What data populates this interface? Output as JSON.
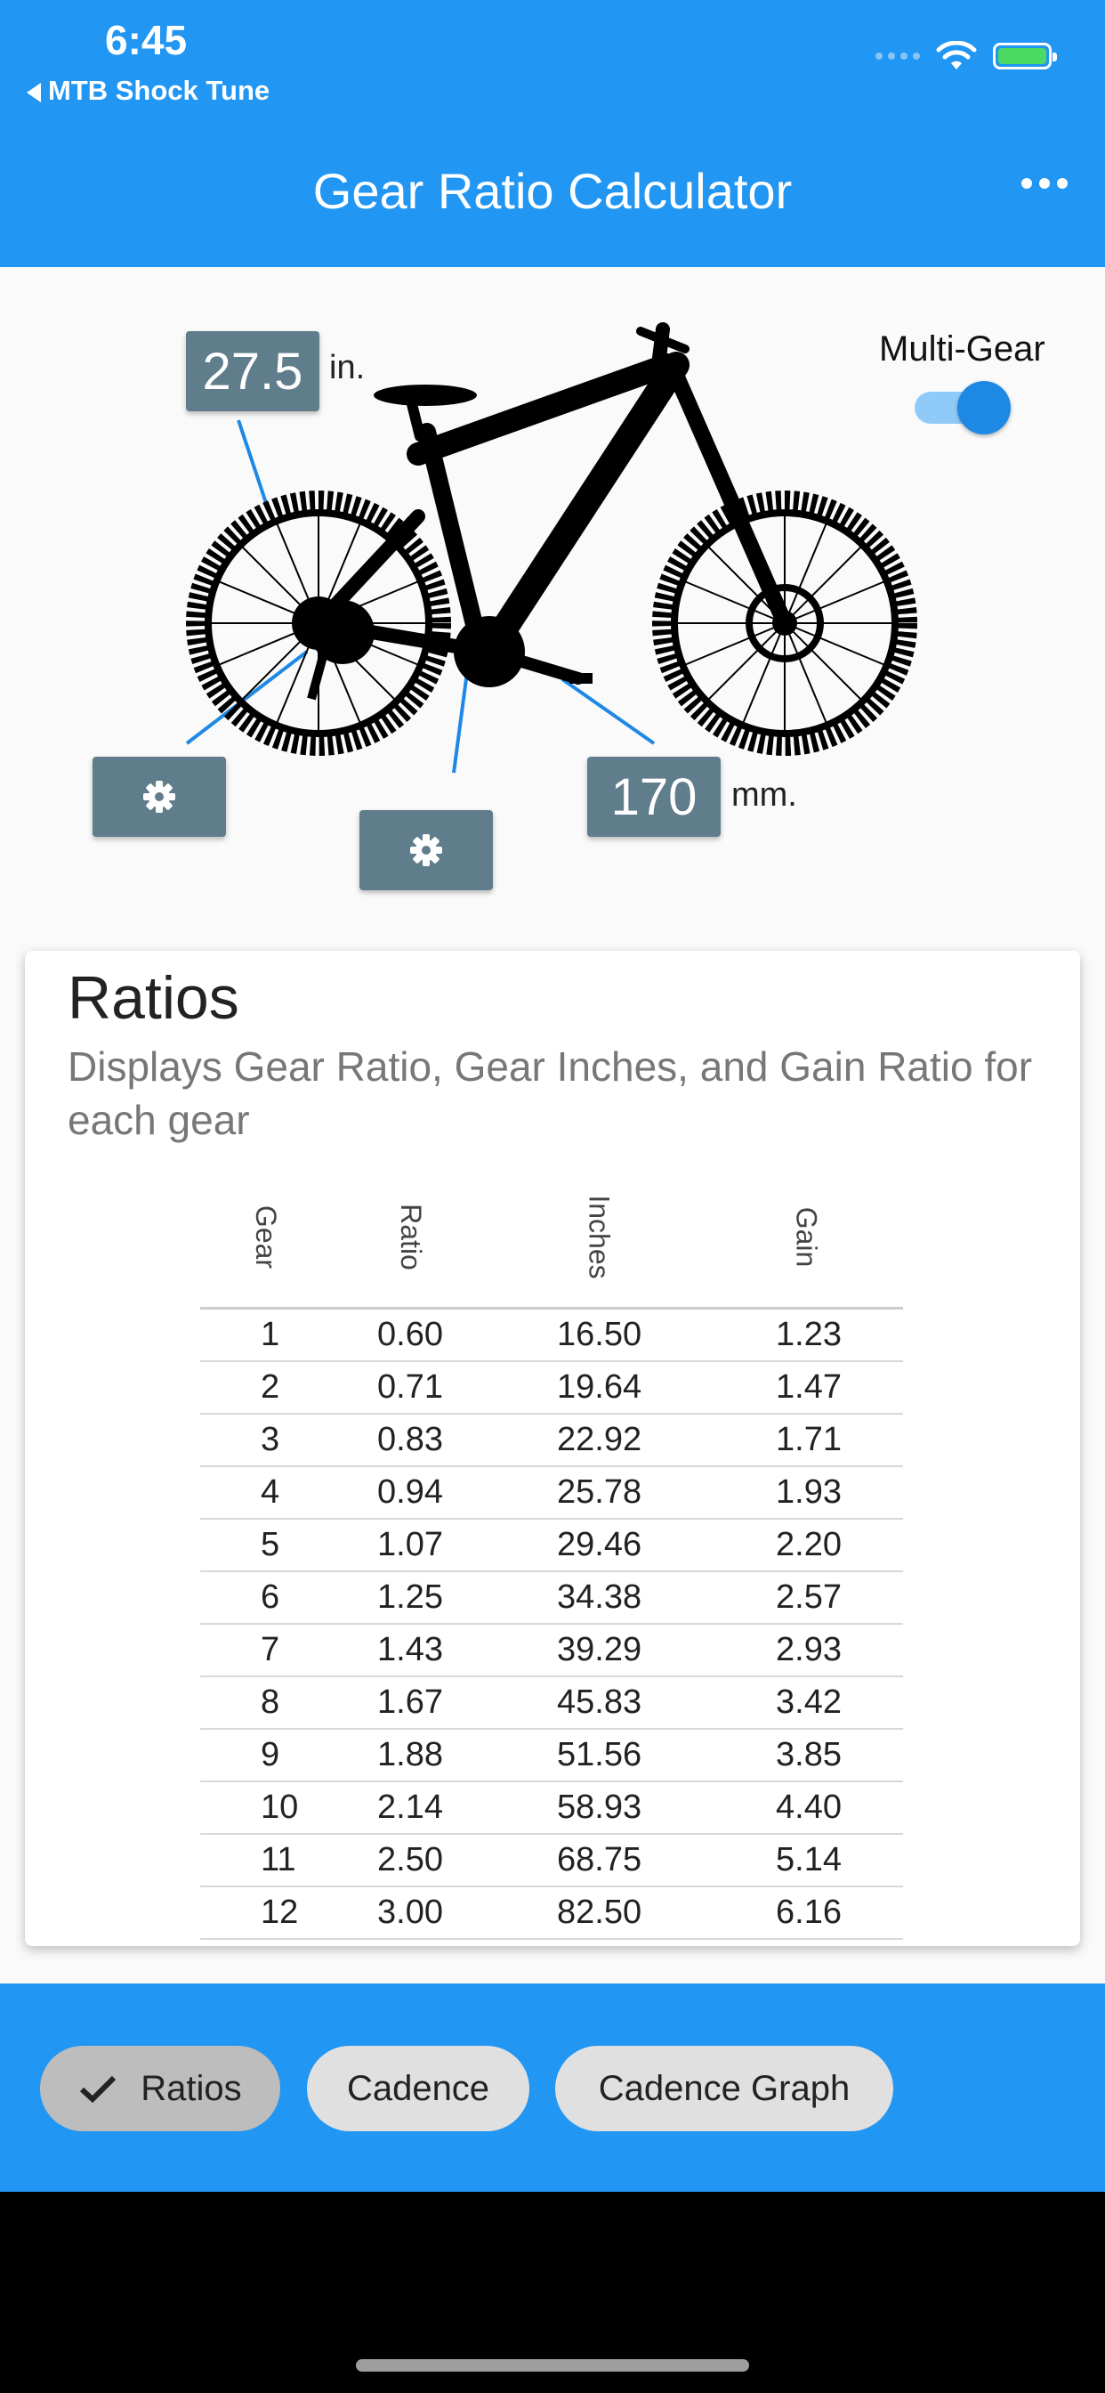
{
  "status_bar": {
    "time": "6:45",
    "back_label": "MTB Shock Tune"
  },
  "app_bar": {
    "title": "Gear Ratio Calculator"
  },
  "bike": {
    "wheel_size": "27.5",
    "wheel_unit": "in.",
    "crank_length": "170",
    "crank_unit": "mm.",
    "multi_gear_label": "Multi-Gear",
    "multi_gear_on": true
  },
  "card": {
    "title": "Ratios",
    "subtitle": "Displays Gear Ratio, Gear Inches, and Gain Ratio for each gear",
    "headers": [
      "Gear",
      "Ratio",
      "Inches",
      "Gain"
    ],
    "rows": [
      [
        "1",
        "0.60",
        "16.50",
        "1.23"
      ],
      [
        "2",
        "0.71",
        "19.64",
        "1.47"
      ],
      [
        "3",
        "0.83",
        "22.92",
        "1.71"
      ],
      [
        "4",
        "0.94",
        "25.78",
        "1.93"
      ],
      [
        "5",
        "1.07",
        "29.46",
        "2.20"
      ],
      [
        "6",
        "1.25",
        "34.38",
        "2.57"
      ],
      [
        "7",
        "1.43",
        "39.29",
        "2.93"
      ],
      [
        "8",
        "1.67",
        "45.83",
        "3.42"
      ],
      [
        "9",
        "1.88",
        "51.56",
        "3.85"
      ],
      [
        "10",
        "2.14",
        "58.93",
        "4.40"
      ],
      [
        "11",
        "2.50",
        "68.75",
        "5.14"
      ],
      [
        "12",
        "3.00",
        "82.50",
        "6.16"
      ]
    ]
  },
  "bottom_nav": {
    "chips": [
      "Ratios",
      "Cadence",
      "Cadence Graph"
    ],
    "selected": "Ratios"
  },
  "colors": {
    "primary": "#2196f3",
    "label_box": "#607d8b",
    "switch_on": "#1e88e5"
  }
}
